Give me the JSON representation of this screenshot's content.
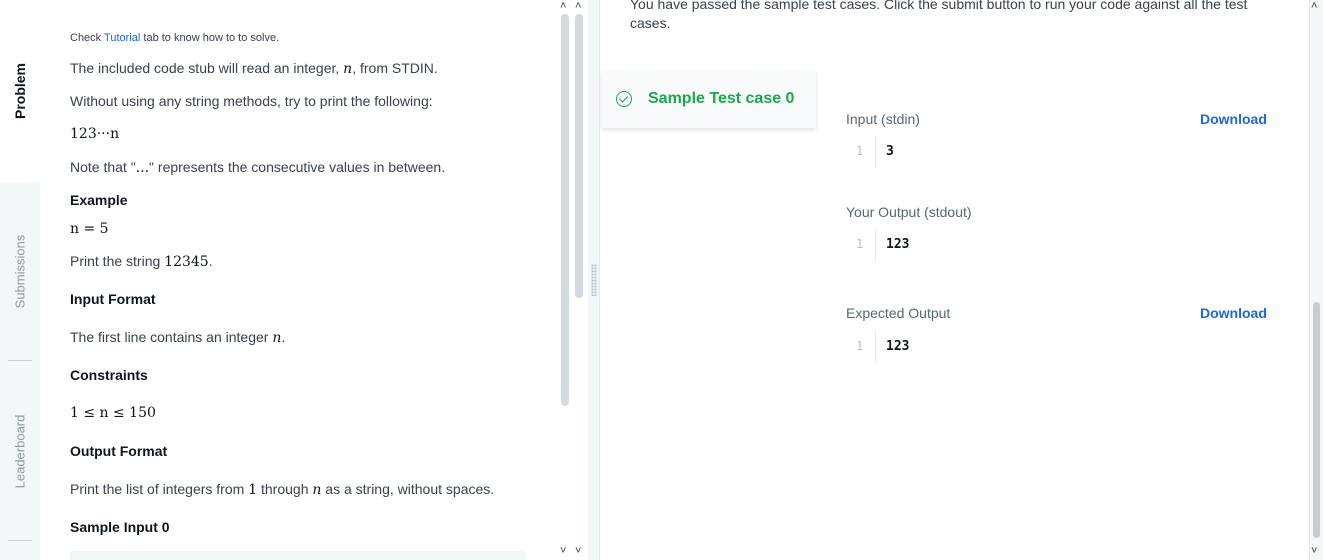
{
  "sidebar": {
    "tabs": [
      {
        "label": "Problem"
      },
      {
        "label": "Submissions"
      },
      {
        "label": "Leaderboard"
      }
    ]
  },
  "problem": {
    "tutorial_prefix": "Check",
    "tutorial_link": "Tutorial",
    "tutorial_suffix": "tab to know how to to solve.",
    "intro": "The included code stub will read an integer,",
    "intro_var": "n",
    "intro_end": ", from STDIN.",
    "instruction": "Without using any string methods, try to print the following:",
    "formula": "123···n",
    "note_prefix": "Note that \"",
    "note_dots": "...",
    "note_suffix": "\" represents the consecutive values in between.",
    "example_heading": "Example",
    "example_value": "n = 5",
    "print_prefix": "Print the string",
    "print_value": "12345",
    "print_end": ".",
    "input_heading": "Input Format",
    "input_text": "The first line contains an integer",
    "input_var": "n",
    "input_end": ".",
    "constraints_heading": "Constraints",
    "constraints_value": "1 ≤ n ≤ 150",
    "output_heading": "Output Format",
    "output_prefix": "Print the list of integers from",
    "output_from": "1",
    "output_mid": "through",
    "output_var": "n",
    "output_suffix": "as a string, without spaces.",
    "sample_heading": "Sample Input 0"
  },
  "result": {
    "message": "You have passed the sample test cases. Click the submit button to run your code against all the test cases.",
    "testcase_label": "Sample Test case 0",
    "input_label": "Input (stdin)",
    "input_download": "Download",
    "input_line": "1",
    "input_value": "3",
    "output_label": "Your Output (stdout)",
    "output_line": "1",
    "output_value": "123",
    "expected_label": "Expected Output",
    "expected_download": "Download",
    "expected_line": "1",
    "expected_value": "123"
  },
  "colors": {
    "accent": "#1d66e5",
    "success": "#1ba94c",
    "text": "#39424e"
  }
}
